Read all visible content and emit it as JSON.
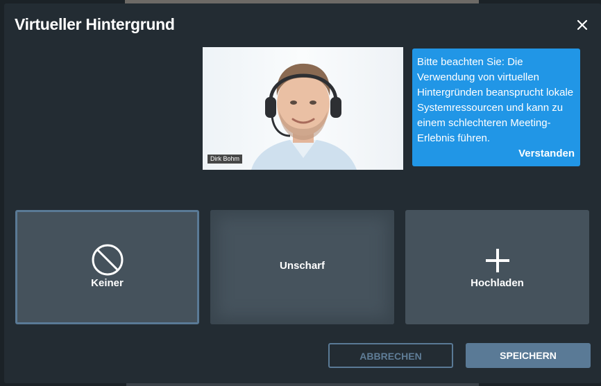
{
  "dialog": {
    "title": "Virtueller Hintergrund"
  },
  "preview": {
    "participant_name": "Dirk Bohm"
  },
  "notice": {
    "text": "Bitte beachten Sie: Die Verwendung von virtuellen Hintergründen beansprucht lokale Systemressourcen und kann zu einem schlechteren Meeting-Erlebnis führen.",
    "action_label": "Verstanden"
  },
  "options": [
    {
      "label": "Keiner",
      "icon": "prohibited-icon",
      "selected": true
    },
    {
      "label": "Unscharf",
      "icon": "",
      "selected": false
    },
    {
      "label": "Hochladen",
      "icon": "plus-icon",
      "selected": false
    }
  ],
  "buttons": {
    "cancel_label": "ABBRECHEN",
    "save_label": "SPEICHERN"
  },
  "colors": {
    "dialog_bg": "#232c33",
    "notice_bg": "#2196e6",
    "accent": "#5a7a96",
    "tile_bg": "#45525c"
  }
}
